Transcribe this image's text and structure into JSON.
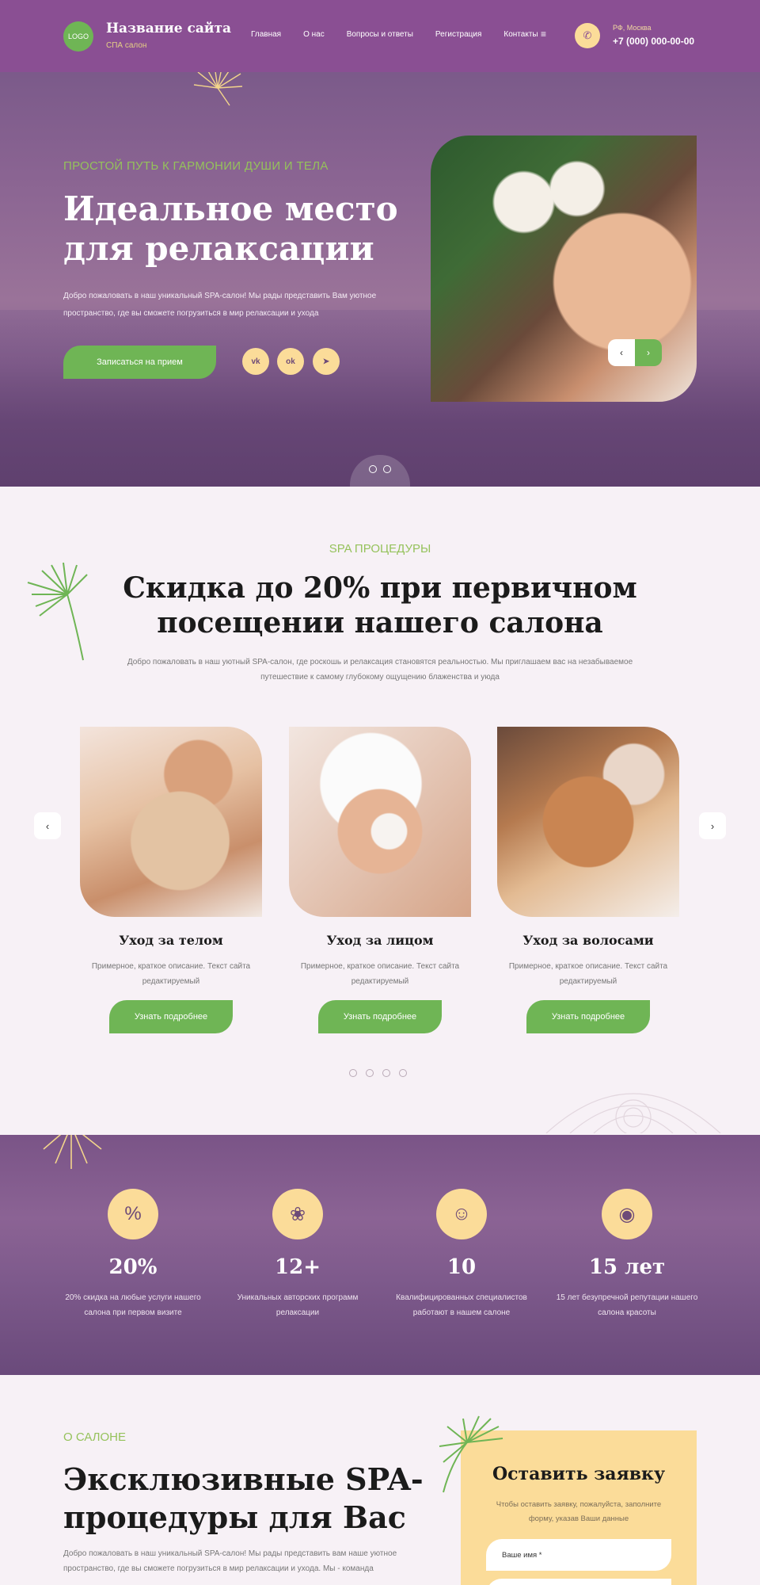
{
  "header": {
    "logo": "LOGO",
    "site_name": "Название сайта",
    "site_sub": "СПА салон",
    "nav": [
      "Главная",
      "О нас",
      "Вопросы и ответы",
      "Регистрация",
      "Контакты"
    ],
    "menu_icon": "≡",
    "city": "РФ, Москва",
    "phone": "+7 (000) 000-00-00",
    "phone_icon": "phone-icon"
  },
  "hero": {
    "tag": "ПРОСТОЙ ПУТЬ К ГАРМОНИИ ДУШИ И ТЕЛА",
    "title": "Идеальное место для релаксации",
    "text": "Добро пожаловать в наш уникальный SPA-салон! Мы рады представить Вам уютное пространство, где вы сможете погрузиться в мир релаксации и ухода",
    "button": "Записаться на прием",
    "social": [
      "vk",
      "ok",
      "telegram"
    ],
    "social_glyphs": [
      "vk",
      "ok",
      "➤"
    ],
    "prev": "‹",
    "next": "›"
  },
  "services": {
    "tag": "SPA ПРОЦЕДУРЫ",
    "title": "Скидка до 20% при первичном посещении нашего салона",
    "text": "Добро пожаловать в наш уютный SPA-салон, где роскошь и релаксация становятся реальностью. Мы приглашаем вас на незабываемое путешествие к самому глубокому ощущению блаженства и уюда",
    "cards": [
      {
        "title": "Уход за телом",
        "text": "Примерное, краткое описание. Текст сайта редактируемый",
        "button": "Узнать подробнее"
      },
      {
        "title": "Уход за лицом",
        "text": "Примерное, краткое описание. Текст сайта редактируемый",
        "button": "Узнать подробнее"
      },
      {
        "title": "Уход за волосами",
        "text": "Примерное, краткое описание. Текст сайта редактируемый",
        "button": "Узнать подробнее"
      }
    ],
    "prev": "‹",
    "next": "›"
  },
  "stats": [
    {
      "num": "20%",
      "text": "20% скидка на любые услуги нашего салона при первом визите",
      "icon": "discount-icon",
      "glyph": "%"
    },
    {
      "num": "12+",
      "text": "Уникальных авторских программ релаксации",
      "icon": "yoga-icon",
      "glyph": "❀"
    },
    {
      "num": "10",
      "text": "Квалифицированных специалистов работают в нашем салоне",
      "icon": "specialist-icon",
      "glyph": "☺"
    },
    {
      "num": "15 лет",
      "text": "15 лет безупречной репутации нашего салона красоты",
      "icon": "stones-icon",
      "glyph": "◉"
    }
  ],
  "about": {
    "tag": "О САЛОНЕ",
    "title": "Эксклюзивные SPA-процедуры для Вас",
    "text": "Добро пожаловать в наш уникальный SPA-салон! Мы рады представить вам наше уютное пространство, где вы сможете погрузиться в мир релаксации и ухода. Мы - команда"
  },
  "form": {
    "title": "Оставить заявку",
    "sub": "Чтобы оставить заявку, пожалуйста, заполните форму, указав Ваши данные",
    "name_placeholder": "Ваше имя *"
  },
  "colors": {
    "purple": "#8a4f93",
    "green": "#6fb555",
    "yellow": "#fbdc99"
  }
}
